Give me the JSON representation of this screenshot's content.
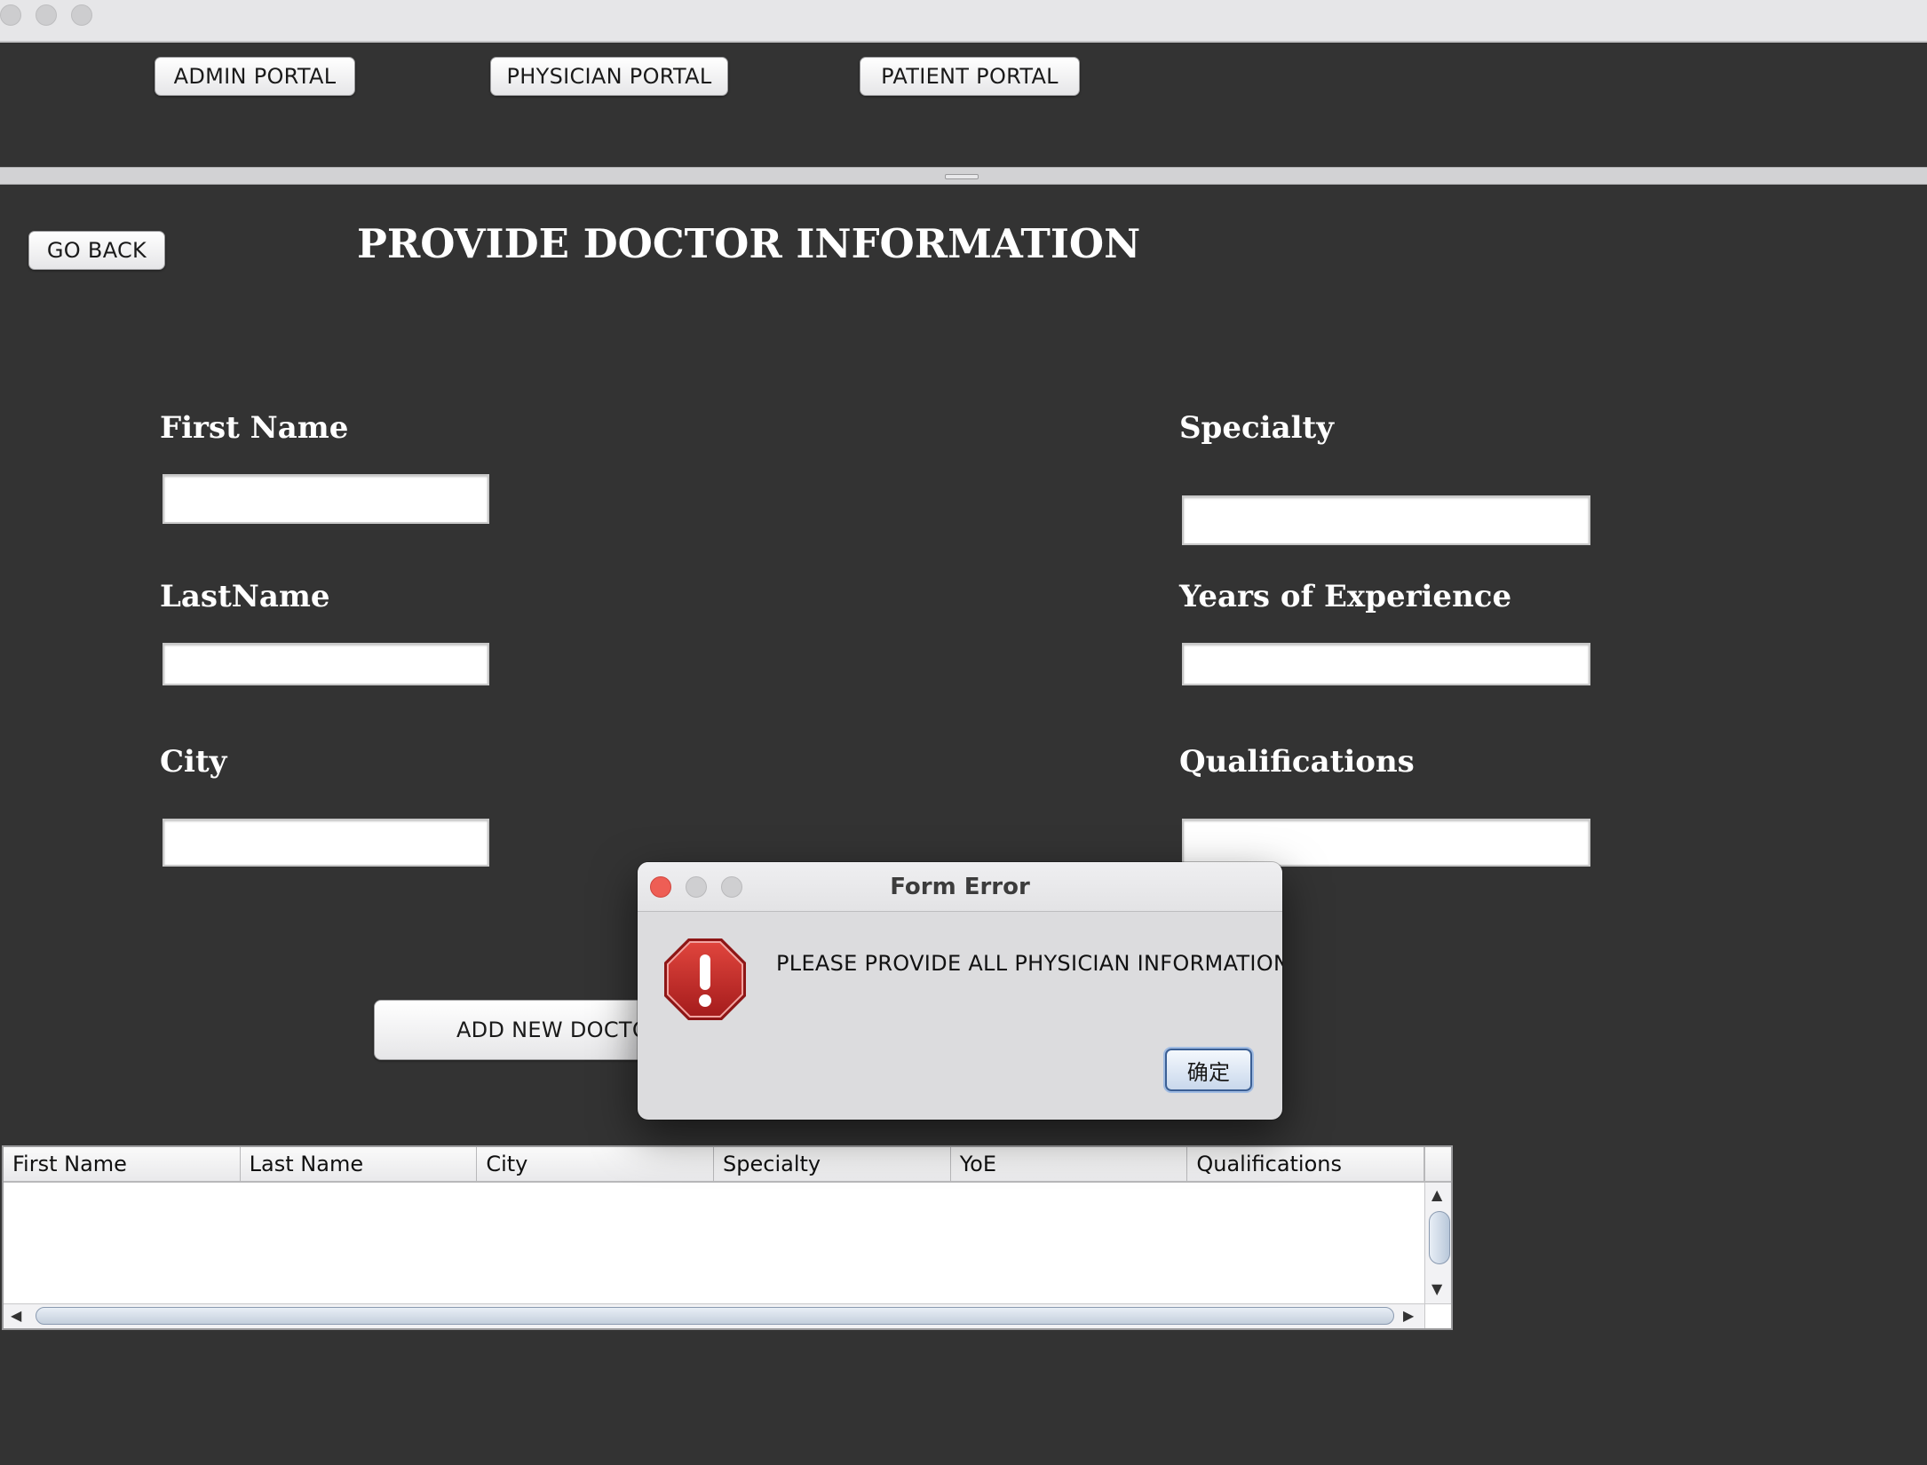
{
  "portals": {
    "admin_label": "ADMIN PORTAL",
    "physician_label": "PHYSICIAN PORTAL",
    "patient_label": "PATIENT PORTAL"
  },
  "page": {
    "go_back_label": "GO BACK",
    "title": "PROVIDE DOCTOR INFORMATION"
  },
  "form": {
    "first_name_label": "First Name",
    "first_name_value": "",
    "last_name_label": "LastName",
    "last_name_value": "",
    "city_label": "City",
    "city_value": "",
    "specialty_label": "Specialty",
    "specialty_value": "",
    "yoe_label": "Years of Experience",
    "yoe_value": "",
    "qualifications_label": "Qualifications",
    "qualifications_value": "",
    "add_button_label": "ADD NEW DOCTOR"
  },
  "table": {
    "columns": [
      "First Name",
      "Last Name",
      "City",
      "Specialty",
      "YoE",
      "Qualifications"
    ],
    "rows": []
  },
  "dialog": {
    "title": "Form Error",
    "message": "PLEASE PROVIDE ALL PHYSICIAN INFORMATION",
    "ok_label": "确定",
    "icon": "error-stop-icon"
  },
  "colors": {
    "background": "#333333",
    "dialog_background": "#dcdcde",
    "error_red": "#c42b2b",
    "close_red": "#ee5e55"
  }
}
